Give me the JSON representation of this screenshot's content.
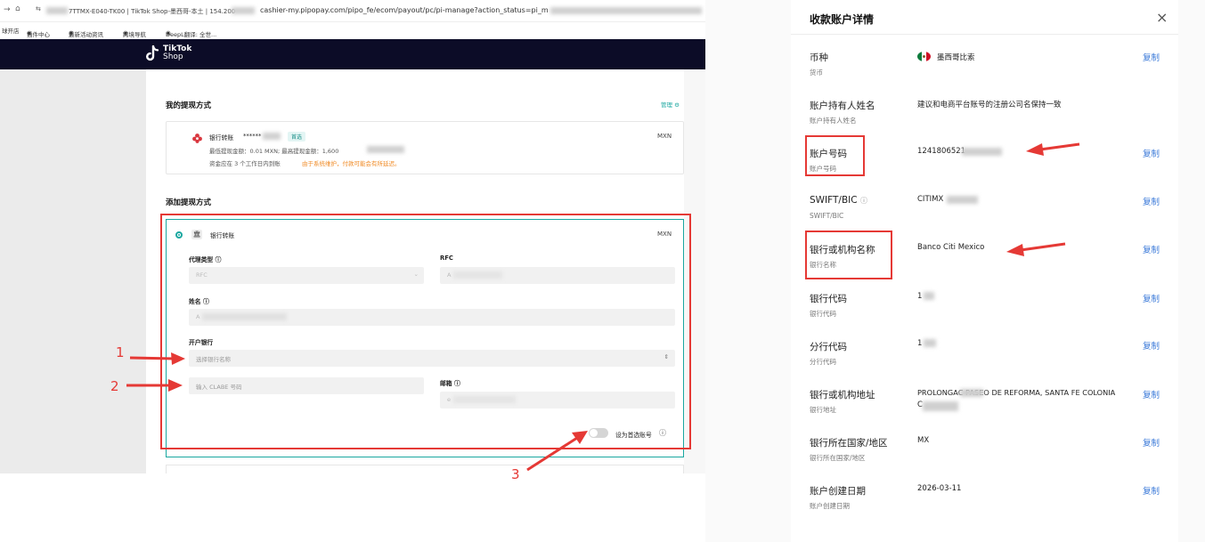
{
  "browser": {
    "tab_text": "7TTMX-E040-TK00 | TikTok Shop-墨西哥-本土 | 154.200",
    "url": "cashier-my.pipopay.com/pipo_fe/ecom/payout/pc/pi-manage?action_status=pi_m",
    "bookmarks": [
      "球开店",
      "插件中心",
      "最新活动资讯",
      "跨境导航",
      "DeepL翻译: 全世..."
    ]
  },
  "logo": {
    "line1": "TikTok",
    "line2": "Shop"
  },
  "left": {
    "my_methods_title": "我的提现方式",
    "manage_label": "管理",
    "bank_card": {
      "type_label": "银行转账",
      "masked_account": "******",
      "preferred_badge": "首选",
      "currency": "MXN",
      "limits_text": "最低提现金额：0.01 MXN; 最高提现金额：1,600",
      "arrival_text": "资金应在 3 个工作日内到账",
      "warning_text": "由于系统维护，付款可能会有所延迟。"
    },
    "add_title": "添加提现方式",
    "new_method": {
      "type_label": "银行转账",
      "currency": "MXN",
      "agent_type_label": "代理类型",
      "agent_type_value": "RFC",
      "rfc_label": "RFC",
      "rfc_value": "A",
      "name_label": "姓名",
      "name_value": "A",
      "bank_label": "开户银行",
      "bank_placeholder": "选择银行名称",
      "clabe_placeholder": "输入 CLABE 号码",
      "email_label": "邮箱",
      "email_value": "e",
      "preferred_toggle_label": "设为首选账号"
    },
    "annotations": [
      "1",
      "2",
      "3"
    ]
  },
  "panel": {
    "title": "收款账户详情",
    "close": "×",
    "copy_label": "复制",
    "rows": [
      {
        "label": "币种",
        "sub": "货币",
        "value": "墨西哥比索",
        "copy": true
      },
      {
        "label": "账户持有人姓名",
        "sub": "账户持有人姓名",
        "value": "建议和电商平台账号的注册公司名保持一致",
        "copy": false
      },
      {
        "label": "账户号码",
        "sub": "账户号码",
        "value": "1241806521",
        "copy": true
      },
      {
        "label": "SWIFT/BIC",
        "sub": "SWIFT/BIC",
        "value": "CITIMX",
        "copy": true
      },
      {
        "label": "银行或机构名称",
        "sub": "银行名称",
        "value": "Banco Citi Mexico",
        "copy": true
      },
      {
        "label": "银行代码",
        "sub": "银行代码",
        "value": "1",
        "copy": true
      },
      {
        "label": "分行代码",
        "sub": "分行代码",
        "value": "1",
        "copy": true
      },
      {
        "label": "银行或机构地址",
        "sub": "银行地址",
        "value": "PROLONGAC PASEO DE REFORMA, SANTA FE COLONIA",
        "value2": "C",
        "copy": true
      },
      {
        "label": "银行所在国家/地区",
        "sub": "银行所在国家/地区",
        "value": "MX",
        "copy": true
      },
      {
        "label": "账户创建日期",
        "sub": "账户创建日期",
        "value": "2026-03-11",
        "copy": true
      }
    ]
  },
  "colors": {
    "nav": "#0c0c27",
    "teal": "#1aa7a0",
    "accent_red": "#e53935",
    "link_blue": "#3b7ad9",
    "warning_orange": "#f08a24"
  }
}
